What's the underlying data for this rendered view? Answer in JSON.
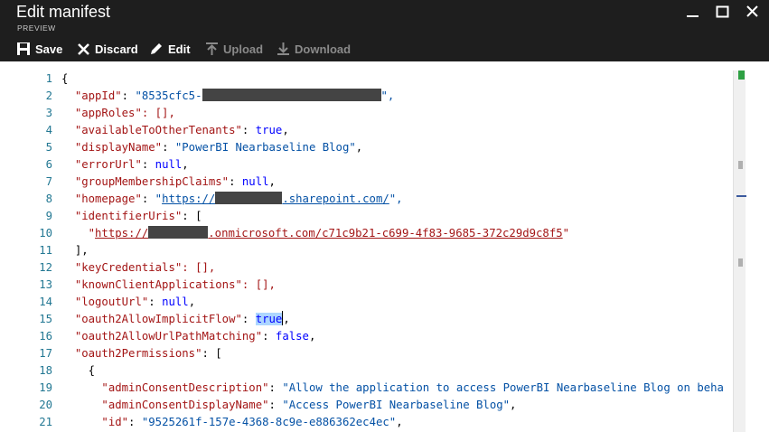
{
  "window": {
    "title": "Edit manifest",
    "subtitle": "PREVIEW"
  },
  "toolbar": {
    "save": "Save",
    "discard": "Discard",
    "edit": "Edit",
    "upload": "Upload",
    "download": "Download"
  },
  "editor": {
    "line_numbers": [
      "1",
      "2",
      "3",
      "4",
      "5",
      "6",
      "7",
      "8",
      "9",
      "10",
      "11",
      "12",
      "13",
      "14",
      "15",
      "16",
      "17",
      "18",
      "19",
      "20",
      "21"
    ],
    "lines": {
      "l1": "{",
      "l2_key": "\"appId\"",
      "l2_val": "\"8535cfc5-",
      "l2_end": "\",",
      "l3": "\"appRoles\": [],",
      "l4_key": "\"availableToOtherTenants\"",
      "l4_val": "true",
      "l5_key": "\"displayName\"",
      "l5_val": "\"PowerBI Nearbaseline Blog\"",
      "l6_key": "\"errorUrl\"",
      "l6_val": "null",
      "l7_key": "\"groupMembershipClaims\"",
      "l7_val": "null",
      "l8_key": "\"homepage\"",
      "l8_q": "\"",
      "l8_link1": "https://",
      "l8_link2": ".sharepoint.com/",
      "l8_end": "\",",
      "l9_key": "\"identifierUris\"",
      "l10_q": "\"",
      "l10_link1": "https://",
      "l10_link2": ".onmicrosoft.com/c71c9b21-c699-4f83-9685-372c29d9c8f5",
      "l10_end": "\"",
      "l11": "],",
      "l12": "\"keyCredentials\": [],",
      "l13": "\"knownClientApplications\": [],",
      "l14_key": "\"logoutUrl\"",
      "l14_val": "null",
      "l15_key": "\"oauth2AllowImplicitFlow\"",
      "l15_val": "true",
      "l16_key": "\"oauth2AllowUrlPathMatching\"",
      "l16_val": "false",
      "l17_key": "\"oauth2Permissions\"",
      "l18": "{",
      "l19_key": "\"adminConsentDescription\"",
      "l19_val": "\"Allow the application to access PowerBI Nearbaseline Blog on beha",
      "l20_key": "\"adminConsentDisplayName\"",
      "l20_val": "\"Access PowerBI Nearbaseline Blog\"",
      "l21_key": "\"id\"",
      "l21_val": "\"9525261f-157e-4368-8c9e-e886362ec4ec\""
    }
  },
  "colors": {
    "header_bg": "#1e1e1e",
    "json_key": "#a31515",
    "json_keyword": "#0000ff",
    "line_number": "#237893",
    "selection": "#add6ff"
  }
}
